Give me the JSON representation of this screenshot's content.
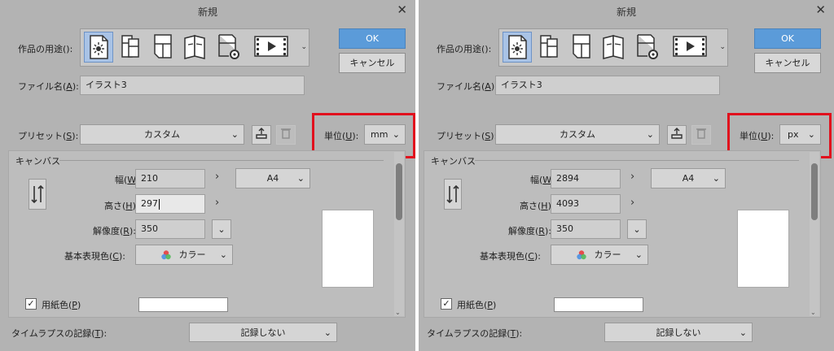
{
  "dialogs": [
    {
      "title": "新規",
      "purpose_label_pre": "作品の用途(",
      "purpose_label_key": "",
      "purpose_label_post": "):",
      "ok_label": "OK",
      "cancel_label": "キャンセル",
      "filename_label_pre": "ファイル名(",
      "filename_label_key": "A",
      "filename_label_post": "):",
      "filename_value": "イラスト3",
      "preset_label_pre": "プリセット(",
      "preset_label_key": "S",
      "preset_label_post": "):",
      "preset_value": "カスタム",
      "unit_label_pre": "単位(",
      "unit_label_key": "U",
      "unit_label_post": "):",
      "unit_value": "mm",
      "canvas_section": "キャンバス",
      "width_label_pre": "幅(",
      "width_label_key": "W",
      "width_label_post": "):",
      "width_value": "210",
      "height_label_pre": "高さ(",
      "height_label_key": "H",
      "height_label_post": "):",
      "height_value": "297",
      "resolution_label_pre": "解像度(",
      "resolution_label_key": "R",
      "resolution_label_post": "):",
      "resolution_value": "350",
      "colormode_label_pre": "基本表現色(",
      "colormode_label_key": "C",
      "colormode_label_post": "):",
      "colormode_value": "カラー",
      "papersize_value": "A4",
      "paper_color_label_pre": "用紙色(",
      "paper_color_label_key": "P",
      "paper_color_label_post": ")",
      "timelapse_label_pre": "タイムラプスの記録(",
      "timelapse_label_key": "T",
      "timelapse_label_post": "):",
      "timelapse_value": "記録しない"
    },
    {
      "title": "新規",
      "purpose_label_pre": "作品の用途(",
      "purpose_label_key": "",
      "purpose_label_post": "):",
      "ok_label": "OK",
      "cancel_label": "キャンセル",
      "filename_label_pre": "ファイル名(",
      "filename_label_key": "A",
      "filename_label_post": "):",
      "filename_value": "イラスト3",
      "preset_label_pre": "プリセット(",
      "preset_label_key": "S",
      "preset_label_post": "):",
      "preset_value": "カスタム",
      "unit_label_pre": "単位(",
      "unit_label_key": "U",
      "unit_label_post": "):",
      "unit_value": "px",
      "canvas_section": "キャンバス",
      "width_label_pre": "幅(",
      "width_label_key": "W",
      "width_label_post": "):",
      "width_value": "2894",
      "height_label_pre": "高さ(",
      "height_label_key": "H",
      "height_label_post": "):",
      "height_value": "4093",
      "resolution_label_pre": "解像度(",
      "resolution_label_key": "R",
      "resolution_label_post": "):",
      "resolution_value": "350",
      "colormode_label_pre": "基本表現色(",
      "colormode_label_key": "C",
      "colormode_label_post": "):",
      "colormode_value": "カラー",
      "papersize_value": "A4",
      "paper_color_label_pre": "用紙色(",
      "paper_color_label_key": "P",
      "paper_color_label_post": ")",
      "timelapse_label_pre": "タイムラプスの記録(",
      "timelapse_label_key": "T",
      "timelapse_label_post": "):",
      "timelapse_value": "記録しない"
    }
  ],
  "purpose_icons": [
    "illustration-icon",
    "webtoon-icon",
    "comic-icon",
    "book-icon",
    "settings-page-icon",
    "animation-icon"
  ],
  "glyphs": {
    "close": "✕",
    "chevron_down": "⌄",
    "chevron_right": "›",
    "checkmark": "✓",
    "rotate": "⤹"
  },
  "colors": {
    "dialog_bg": "#b3b3b3",
    "ok_button": "#5b9bd9",
    "highlight_box": "#e1101d",
    "selected_icon": "#a9c3e6",
    "paper": "#ffffff"
  }
}
